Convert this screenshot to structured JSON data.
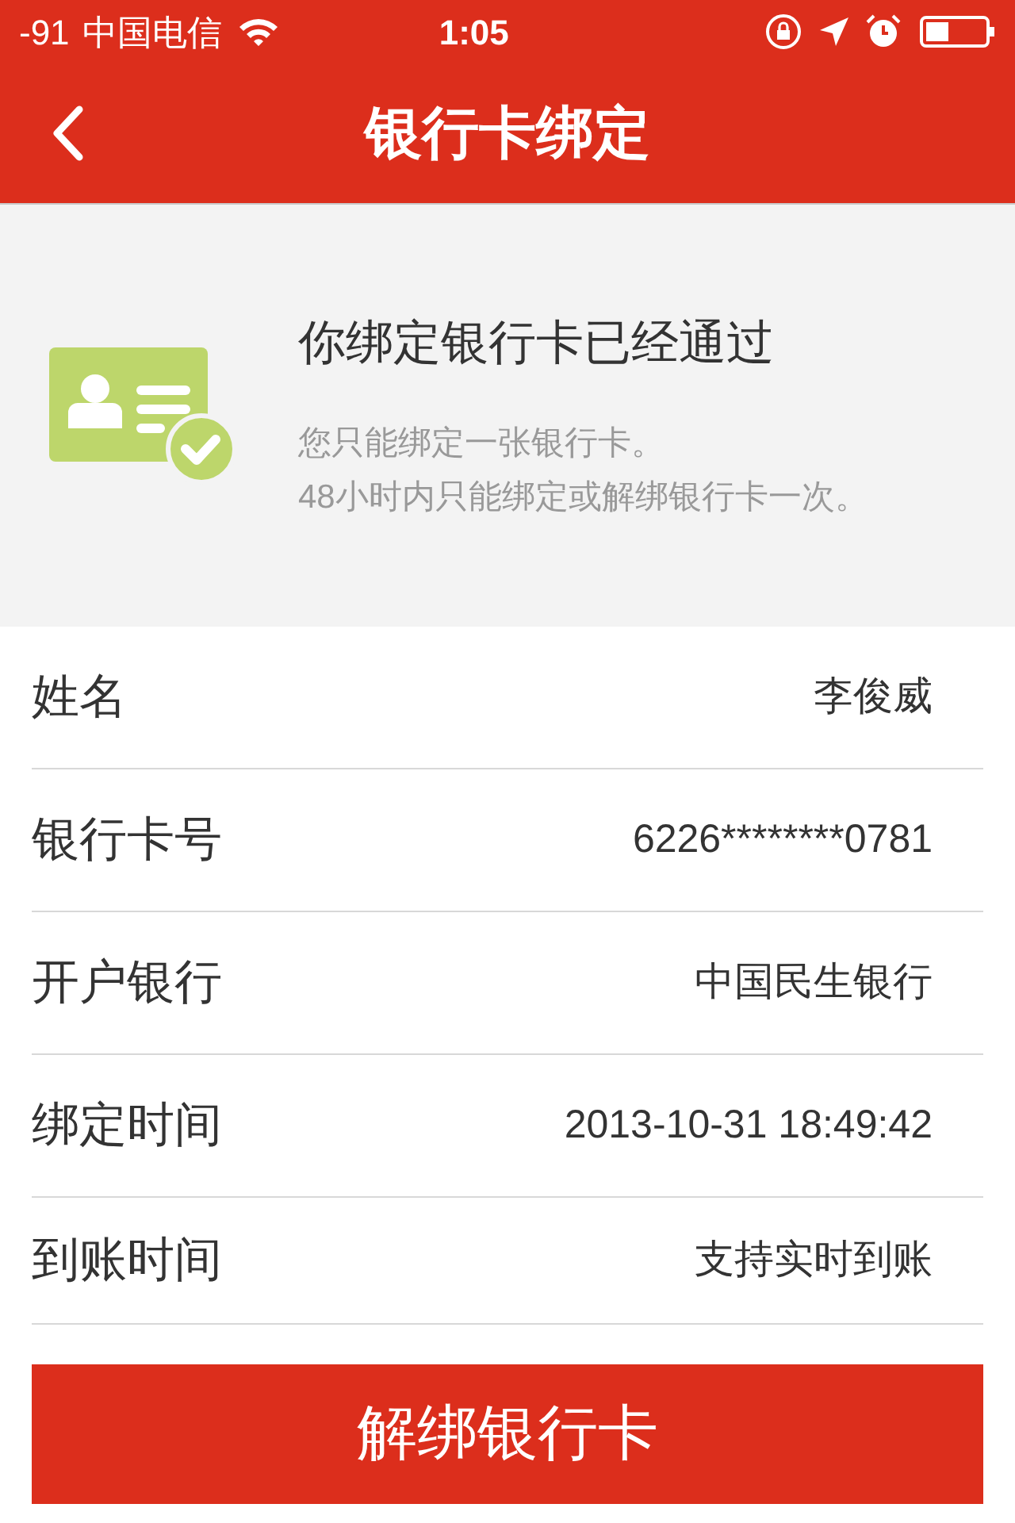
{
  "status_bar": {
    "signal": "-91",
    "carrier": "中国电信",
    "time": "1:05"
  },
  "nav": {
    "title": "银行卡绑定"
  },
  "notice": {
    "title": "你绑定银行卡已经通过",
    "lines": [
      "您只能绑定一张银行卡。",
      "48小时内只能绑定或解绑银行卡一次。"
    ]
  },
  "fields": [
    {
      "label": "姓名",
      "value": "李俊威"
    },
    {
      "label": "银行卡号",
      "value": "6226********0781"
    },
    {
      "label": "开户银行",
      "value": "中国民生银行"
    },
    {
      "label": "绑定时间",
      "value": "2013-10-31 18:49:42"
    },
    {
      "label": "到账时间",
      "value": "支持实时到账"
    }
  ],
  "button": {
    "label": "解绑银行卡"
  }
}
